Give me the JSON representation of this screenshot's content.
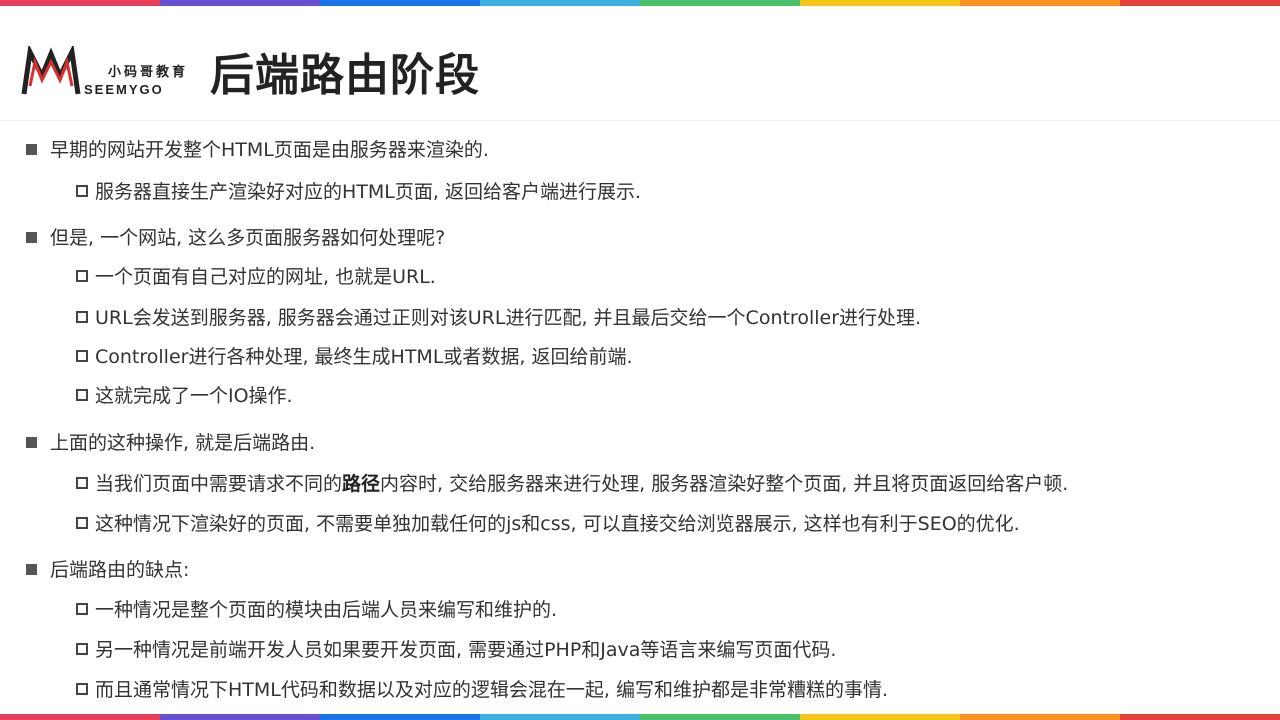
{
  "colors": {
    "stripe": [
      "#e83e5a",
      "#6a4fd1",
      "#1a73e8",
      "#3bb0e0",
      "#4cc36b",
      "#f5c518",
      "#f7931e",
      "#e8413c"
    ],
    "logo_red": "#d9302e",
    "logo_dark": "#222222"
  },
  "logo": {
    "icon": "seemygo-m-logo-icon",
    "cn": "小码哥教育",
    "en": "SEEMYGO"
  },
  "title": "后端路由阶段",
  "bullets": [
    {
      "text": "早期的网站开发整个HTML页面是由服务器来渲染的.",
      "children": [
        "服务器直接生产渲染好对应的HTML页面, 返回给客户端进行展示."
      ]
    },
    {
      "text": "但是, 一个网站, 这么多页面服务器如何处理呢?",
      "children": [
        "一个页面有自己对应的网址, 也就是URL.",
        "URL会发送到服务器, 服务器会通过正则对该URL进行匹配, 并且最后交给一个Controller进行处理.",
        "Controller进行各种处理, 最终生成HTML或者数据, 返回给前端.",
        "这就完成了一个IO操作."
      ]
    },
    {
      "text": "上面的这种操作, 就是后端路由.",
      "children": [
        {
          "before": "当我们页面中需要请求不同的",
          "bold": "路径",
          "after": "内容时, 交给服务器来进行处理, 服务器渲染好整个页面, 并且将页面返回给客户顿."
        },
        "这种情况下渲染好的页面, 不需要单独加载任何的js和css, 可以直接交给浏览器展示, 这样也有利于SEO的优化."
      ]
    },
    {
      "text": "后端路由的缺点:",
      "children": [
        "一种情况是整个页面的模块由后端人员来编写和维护的.",
        "另一种情况是前端开发人员如果要开发页面, 需要通过PHP和Java等语言来编写页面代码.",
        "而且通常情况下HTML代码和数据以及对应的逻辑会混在一起, 编写和维护都是非常糟糕的事情."
      ]
    }
  ]
}
